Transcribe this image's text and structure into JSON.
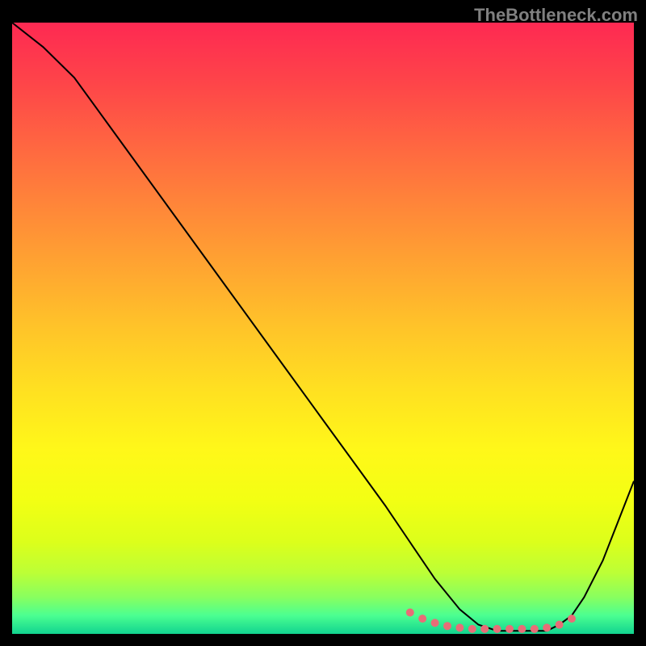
{
  "watermark": "TheBottleneck.com",
  "chart_data": {
    "type": "line",
    "title": "",
    "xlabel": "",
    "ylabel": "",
    "xlim": [
      0,
      100
    ],
    "ylim": [
      0,
      100
    ],
    "series": [
      {
        "name": "curve",
        "x": [
          0,
          5,
          10,
          15,
          20,
          25,
          30,
          35,
          40,
          45,
          50,
          55,
          60,
          64,
          68,
          72,
          75,
          78,
          80,
          82,
          84,
          86,
          88,
          90,
          92,
          95,
          100
        ],
        "values": [
          100,
          96,
          91,
          84,
          77,
          70,
          63,
          56,
          49,
          42,
          35,
          28,
          21,
          15,
          9,
          4,
          1.5,
          0.5,
          0.5,
          0.5,
          0.5,
          0.5,
          1.5,
          3,
          6,
          12,
          25
        ]
      }
    ],
    "dots": {
      "x": [
        64,
        66,
        68,
        70,
        72,
        74,
        76,
        78,
        80,
        82,
        84,
        86,
        88,
        90
      ],
      "values": [
        3.5,
        2.5,
        1.8,
        1.3,
        1.0,
        0.8,
        0.8,
        0.8,
        0.8,
        0.8,
        0.8,
        1.0,
        1.5,
        2.5
      ]
    },
    "gradient_stops": [
      {
        "pos": 0,
        "color": "#fe2952"
      },
      {
        "pos": 50,
        "color": "#ffc429"
      },
      {
        "pos": 80,
        "color": "#f3ff13"
      },
      {
        "pos": 100,
        "color": "#11d38f"
      }
    ]
  }
}
